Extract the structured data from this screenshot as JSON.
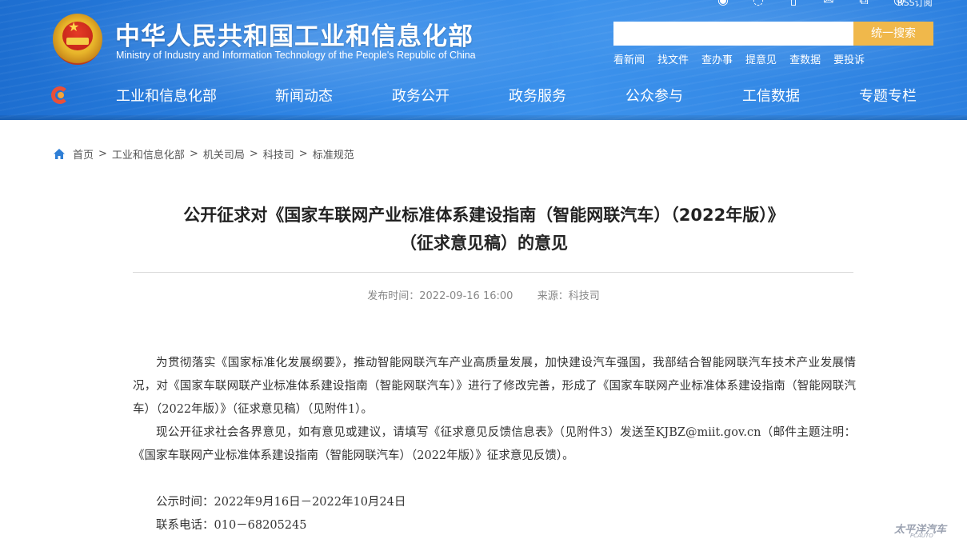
{
  "header": {
    "site_title": "中华人民共和国工业和信息化部",
    "site_subtitle": "Ministry of Industry and Information Technology of the People's Republic of China",
    "rss_label": "RSS订阅",
    "search": {
      "placeholder": "",
      "button": "统一搜索"
    },
    "quick_links": [
      "看新闻",
      "找文件",
      "查办事",
      "提意见",
      "查数据",
      "要投诉"
    ],
    "top_icons": [
      "weibo-icon",
      "wechat-icon",
      "mobile-icon",
      "mail-icon",
      "share-icon",
      "rss-icon"
    ]
  },
  "nav": {
    "items": [
      "工业和信息化部",
      "新闻动态",
      "政务公开",
      "政务服务",
      "公众参与",
      "工信数据",
      "专题专栏"
    ]
  },
  "breadcrumb": [
    "首页",
    "工业和信息化部",
    "机关司局",
    "科技司",
    "标准规范"
  ],
  "article": {
    "title_line1": "公开征求对《国家车联网产业标准体系建设指南（智能网联汽车）（2022年版）》",
    "title_line2": "（征求意见稿）的意见",
    "publish_label": "发布时间：",
    "publish_time": "2022-09-16 16:00",
    "source_label": "来源：",
    "source": "科技司",
    "para1": "为贯彻落实《国家标准化发展纲要》，推动智能网联汽车产业高质量发展，加快建设汽车强国，我部结合智能网联汽车技术产业发展情况，对《国家车联网联产业标准体系建设指南（智能网联汽车）》进行了修改完善，形成了《国家车联网产业标准体系建设指南（智能网联汽车）（2022年版）》（征求意见稿）（见附件1）。",
    "para2": "现公开征求社会各界意见，如有意见或建议，请填写《征求意见反馈信息表》（见附件3）发送至KJBZ@miit.gov.cn（邮件主题注明：《国家车联网产业标准体系建设指南（智能网联汽车）（2022年版）》征求意见反馈）。",
    "notice_period": "公示时间：2022年9月16日－2022年10月24日",
    "contact_phone": "联系电话：010－68205245"
  },
  "watermark": {
    "main": "太平洋汽车",
    "sub": "PCAUTO"
  },
  "colors": {
    "header_blue": "#2f86e6",
    "search_button": "#f0b84b",
    "nav_logo_red": "#e8503a"
  }
}
